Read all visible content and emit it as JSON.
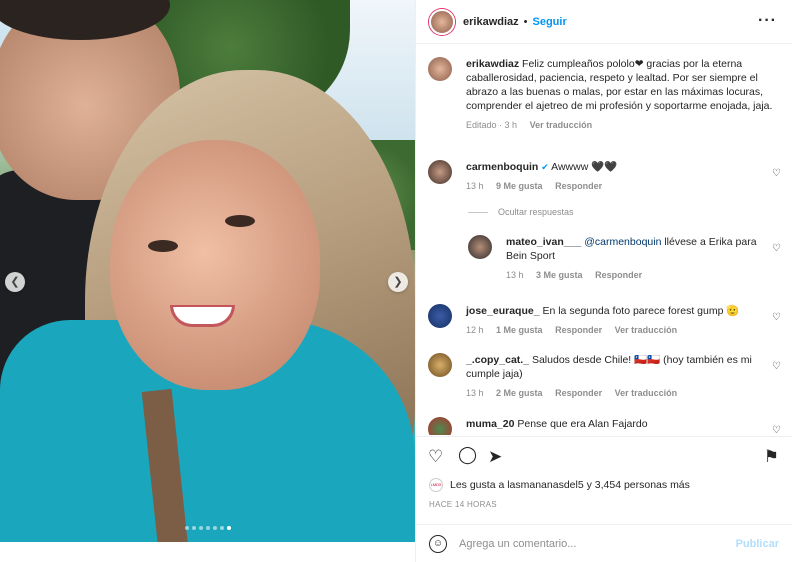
{
  "post": {
    "user": "erikawdiaz",
    "separator": "•",
    "follow_label": "Seguir",
    "more_label": "•••",
    "carousel": {
      "dots_total": 7,
      "active_index": 6,
      "prev_icon": "chevron-left",
      "next_icon": "chevron-right"
    }
  },
  "caption": {
    "user": "erikawdiaz",
    "text": "Feliz cumpleaños pololo❤ gracias por la eterna caballerosidad, paciencia, respeto y lealtad. Por ser siempre el abrazo a las buenas o malas, por estar en las máximas locuras, comprender el ajetreo de mi profesión y soportarme enojada, jaja.",
    "edited": "Editado · 3 h",
    "translate": "Ver traducción"
  },
  "comments": [
    {
      "user": "carmenboquin",
      "verified": true,
      "text": "Awwww 🖤🖤",
      "time": "13 h",
      "likes": "9 Me gusta",
      "reply": "Responder"
    },
    {
      "user": "mateo_ivan___",
      "mention": "@carmenboquin",
      "text": " llévese a Erika para Bein Sport",
      "time": "13 h",
      "likes": "3 Me gusta",
      "reply": "Responder"
    },
    {
      "user": "jose_euraque_",
      "text": "En la segunda foto parece forest gump 🫡",
      "time": "12 h",
      "likes": "1 Me gusta",
      "reply": "Responder",
      "translate": "Ver traducción"
    },
    {
      "user": "_.copy_cat._",
      "text": "Saludos desde Chile! 🇨🇱🇨🇱 (hoy también es mi cumple jaja)",
      "time": "13 h",
      "likes": "2 Me gusta",
      "reply": "Responder",
      "translate": "Ver traducción"
    },
    {
      "user": "muma_20",
      "text": "Pense que era Alan Fajardo"
    }
  ],
  "hide_replies": "Ocultar respuestas",
  "likes_text": "Les gusta a lasmananasdel5 y 3,454 personas más",
  "likes_avatar_text": "LMD5",
  "timestamp": "HACE 14 HORAS",
  "add_comment": {
    "placeholder": "Agrega un comentario...",
    "publish": "Publicar"
  },
  "colors": {
    "link": "#0095f6",
    "muted": "#8e8e8e",
    "shirt": "#1aa7bd"
  }
}
